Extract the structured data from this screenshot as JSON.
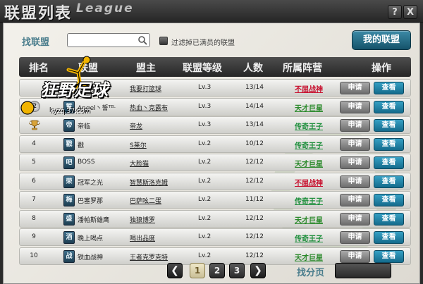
{
  "window": {
    "title_cn": "联盟列表",
    "title_en": "League",
    "help_label": "?",
    "close_label": "X"
  },
  "search": {
    "label": "找联盟",
    "value": "",
    "placeholder": "",
    "checkbox_label": "过滤掉已满员的联盟"
  },
  "my_league_label": "我的联盟",
  "logo": {
    "text": "狂野足球",
    "site": "kyzq.37.com"
  },
  "columns": {
    "rank": "排名",
    "league": "联盟",
    "leader": "盟主",
    "level": "联盟等级",
    "count": "人数",
    "camp": "所属阵营",
    "action": "操作"
  },
  "button_labels": {
    "apply": "申请",
    "view": "查看"
  },
  "camp_colors": {
    "不屈战神": "#c8102e",
    "天才巨星": "#2c8a2c",
    "传奇王子": "#1e8f3c"
  },
  "rows": [
    {
      "rank": "1",
      "emblem": "",
      "name": "落的水",
      "leader": "我要打篮球",
      "level": "Lv.3",
      "count": "13/14",
      "camp": "不屈战神"
    },
    {
      "rank": "2",
      "emblem": "誓",
      "name": "Angel丶誓ᵀᴱᴸ",
      "leader": "热血丶克露布",
      "level": "Lv.3",
      "count": "14/14",
      "camp": "天才巨星"
    },
    {
      "rank": "3",
      "emblem": "帝",
      "name": "帝临",
      "leader": "帝龙",
      "level": "Lv.3",
      "count": "13/14",
      "camp": "传奇王子"
    },
    {
      "rank": "4",
      "emblem": "戳",
      "name": "戳",
      "leader": "S莱尔",
      "level": "Lv.2",
      "count": "10/12",
      "camp": "传奇王子"
    },
    {
      "rank": "5",
      "emblem": "吧",
      "name": "BOSS",
      "leader": "大脸猫",
      "level": "Lv.2",
      "count": "12/12",
      "camp": "天才巨星"
    },
    {
      "rank": "6",
      "emblem": "荣",
      "name": "冠军之光",
      "leader": "智慧斯洛克姆",
      "level": "Lv.2",
      "count": "12/12",
      "camp": "不屈战神"
    },
    {
      "rank": "7",
      "emblem": "梅",
      "name": "巴塞罗那",
      "leader": "巴萨吆二蛋",
      "level": "Lv.2",
      "count": "11/12",
      "camp": "传奇王子"
    },
    {
      "rank": "8",
      "emblem": "盛",
      "name": "潘帕斯雄鹰",
      "leader": "独狼博罗",
      "level": "Lv.2",
      "count": "12/12",
      "camp": "天才巨星"
    },
    {
      "rank": "9",
      "emblem": "酒",
      "name": "晚上喝点",
      "leader": "喝出品度",
      "level": "Lv.2",
      "count": "12/12",
      "camp": "传奇王子"
    },
    {
      "rank": "10",
      "emblem": "战",
      "name": "铁血战神",
      "leader": "王者克罗克特",
      "level": "Lv.2",
      "count": "12/12",
      "camp": "天才巨星"
    }
  ],
  "pagination": {
    "prev": "❮",
    "pages": [
      "1",
      "2",
      "3"
    ],
    "current": "1",
    "next": "❯",
    "find_label": "找分页",
    "page_input_value": ""
  }
}
